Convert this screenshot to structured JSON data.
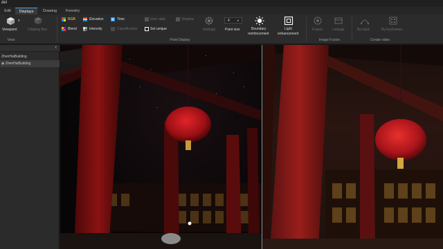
{
  "window": {
    "title": "del"
  },
  "menu": {
    "tabs": [
      {
        "label": "Edit",
        "active": false
      },
      {
        "label": "Displays",
        "active": true
      },
      {
        "label": "Drawing",
        "active": false
      },
      {
        "label": "Forestry",
        "active": false
      }
    ]
  },
  "ribbon": {
    "view": {
      "viewpoint": "Viewpoint",
      "clipping_box": "Clipping Box",
      "group": "View"
    },
    "point_display": {
      "rgb": "RGB",
      "elevation": "Elevation",
      "time": "Time",
      "user_data": "User data",
      "shadow": "Shadow",
      "blend": "Blend",
      "intensity": "Intensity",
      "classification": "Classification",
      "set_unique": "Set unique",
      "settings": "Settings",
      "point_size_label": "Point size",
      "point_size_value": "4",
      "boundary_reinforcement_1": "Boundary",
      "boundary_reinforcement_2": "reinforcement",
      "light_enhancement_1": "Light",
      "light_enhancement_2": "enhancement",
      "group": "Point Display"
    },
    "image_fusion": {
      "fusion": "Fusion",
      "linkage": "Linkage",
      "group": "Image Fusion"
    },
    "create_video": {
      "by_track": "By track",
      "by_keyframes": "By keyframes",
      "group": "Create video"
    }
  },
  "left_panel": {
    "items": [
      {
        "label": "ZhenHaiBuilding",
        "has_eye": false
      },
      {
        "label": "ZhenHaiBuilding",
        "has_eye": true
      }
    ]
  },
  "colors": {
    "accent": "#4d9be6",
    "ribbon_bg": "#2b2b2b",
    "lantern_red": "#c8181c",
    "pillar_red": "#7e1010"
  }
}
